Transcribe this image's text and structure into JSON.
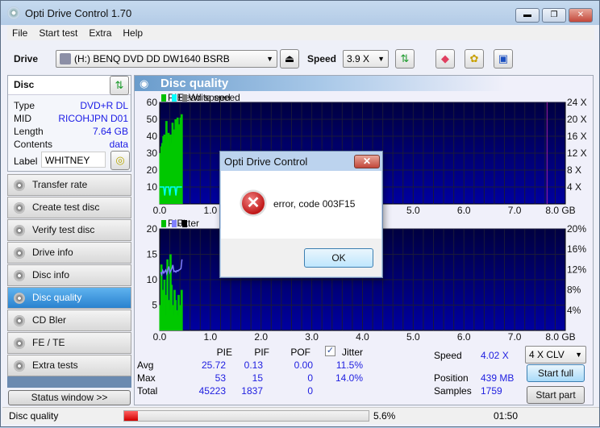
{
  "window": {
    "title": "Opti Drive Control 1.70",
    "minimize": "▬",
    "maximize": "❐",
    "close": "✕"
  },
  "menu": [
    "File",
    "Start test",
    "Extra",
    "Help"
  ],
  "toolbar": {
    "drive_label": "Drive",
    "drive_value": "(H:)   BENQ DVD DD DW1640 BSRB",
    "speed_label": "Speed",
    "speed_value": "3.9 X"
  },
  "disc": {
    "header": "Disc",
    "rows": [
      {
        "k": "Type",
        "v": "DVD+R DL"
      },
      {
        "k": "MID",
        "v": "RICOHJPN D01"
      },
      {
        "k": "Length",
        "v": "7.64 GB"
      },
      {
        "k": "Contents",
        "v": "data"
      }
    ],
    "label_key": "Label",
    "label_value": "WHITNEY"
  },
  "nav": [
    "Transfer rate",
    "Create test disc",
    "Verify test disc",
    "Drive info",
    "Disc info",
    "Disc quality",
    "CD Bler",
    "FE / TE",
    "Extra tests"
  ],
  "nav_selected": 5,
  "status_window_button": "Status window >>",
  "main": {
    "title": "Disc quality"
  },
  "chart_data": [
    {
      "type": "bar",
      "legend": [
        "PIE",
        "Read speed",
        "Write speed"
      ],
      "colors": {
        "PIE": "#00c000",
        "Read speed": "#00ffff",
        "Write speed": "#808080"
      },
      "xlim": [
        0,
        8
      ],
      "xunit": "GB",
      "xticks": [
        "0.0",
        "1.0",
        "2.0",
        "3.0",
        "4.0",
        "5.0",
        "6.0",
        "7.0",
        "8.0 GB"
      ],
      "ylim": [
        0,
        60
      ],
      "yticks": [
        "60",
        "50",
        "40",
        "30",
        "20",
        "10"
      ],
      "y2ticks": [
        "24 X",
        "20 X",
        "16 X",
        "12 X",
        "8 X",
        "4 X"
      ],
      "y2lim": [
        0,
        24
      ],
      "disc_end_gb": 7.64,
      "x": [
        0.02,
        0.04,
        0.06,
        0.08,
        0.1,
        0.12,
        0.14,
        0.16,
        0.18,
        0.2,
        0.22,
        0.24,
        0.26,
        0.28,
        0.3,
        0.32,
        0.34,
        0.36,
        0.38,
        0.4,
        0.42,
        0.44
      ],
      "pie": [
        30,
        34,
        36,
        40,
        41,
        36,
        49,
        38,
        42,
        34,
        41,
        36,
        48,
        40,
        44,
        50,
        46,
        51,
        44,
        47,
        51,
        53
      ],
      "read_speed": [
        4.0,
        4.0,
        4.0,
        4.0,
        2.0,
        4.0,
        4.0,
        4.0,
        4.0,
        2.0,
        4.0,
        4.0,
        4.0,
        4.0,
        4.0,
        2.0,
        4.0,
        4.0,
        4.0,
        4.0,
        4.0,
        4.0
      ]
    },
    {
      "type": "bar",
      "legend": [
        "PIF",
        "Jitter"
      ],
      "colors": {
        "PIF": "#00c000",
        "Jitter": "#8080ff"
      },
      "xlim": [
        0,
        8
      ],
      "xticks": [
        "0.0",
        "1.0",
        "2.0",
        "3.0",
        "4.0",
        "5.0",
        "6.0",
        "7.0",
        "8.0 GB"
      ],
      "ylim": [
        0,
        20
      ],
      "yticks": [
        "20",
        "15",
        "10",
        "5"
      ],
      "y2ticks": [
        "20%",
        "16%",
        "12%",
        "8%",
        "4%"
      ],
      "y2lim": [
        0,
        20
      ],
      "x": [
        0.02,
        0.04,
        0.06,
        0.08,
        0.1,
        0.12,
        0.14,
        0.16,
        0.18,
        0.2,
        0.22,
        0.24,
        0.26,
        0.28,
        0.3,
        0.32,
        0.34,
        0.36,
        0.38,
        0.4,
        0.42,
        0.44
      ],
      "pif": [
        5,
        13,
        8,
        4,
        10,
        3,
        7,
        14,
        6,
        4,
        15,
        9,
        5,
        3,
        8,
        6,
        4,
        3,
        7,
        5,
        4,
        8
      ],
      "jitter": [
        11.5,
        11.0,
        11.8,
        11.3,
        11.6,
        11.9,
        11.2,
        12.0,
        12.6,
        11.4,
        11.8,
        12.2,
        12.9,
        11.6,
        11.7,
        11.5,
        11.8,
        11.7,
        11.9,
        12.0,
        12.2,
        14.0
      ]
    }
  ],
  "stats": {
    "cols": [
      "PIE",
      "PIF",
      "POF"
    ],
    "jitter_label": "Jitter",
    "jitter_checked": true,
    "rows": [
      {
        "k": "Avg",
        "v": [
          "25.72",
          "0.13",
          "0.00",
          "11.5%"
        ]
      },
      {
        "k": "Max",
        "v": [
          "53",
          "15",
          "0",
          "14.0%"
        ]
      },
      {
        "k": "Total",
        "v": [
          "45223",
          "1837",
          "0",
          ""
        ]
      }
    ],
    "speed_label": "Speed",
    "speed_value": "4.02 X",
    "position_label": "Position",
    "position_value": "439 MB",
    "samples_label": "Samples",
    "samples_value": "1759",
    "mode_value": "4 X CLV",
    "start_full": "Start full",
    "start_part": "Start part"
  },
  "statusbar": {
    "text": "Disc quality",
    "progress": 5.6,
    "progress_text": "5.6%",
    "time": "01:50"
  },
  "dialog": {
    "title": "Opti Drive Control",
    "message": "error, code 003F15",
    "ok": "OK",
    "close": "✕"
  }
}
